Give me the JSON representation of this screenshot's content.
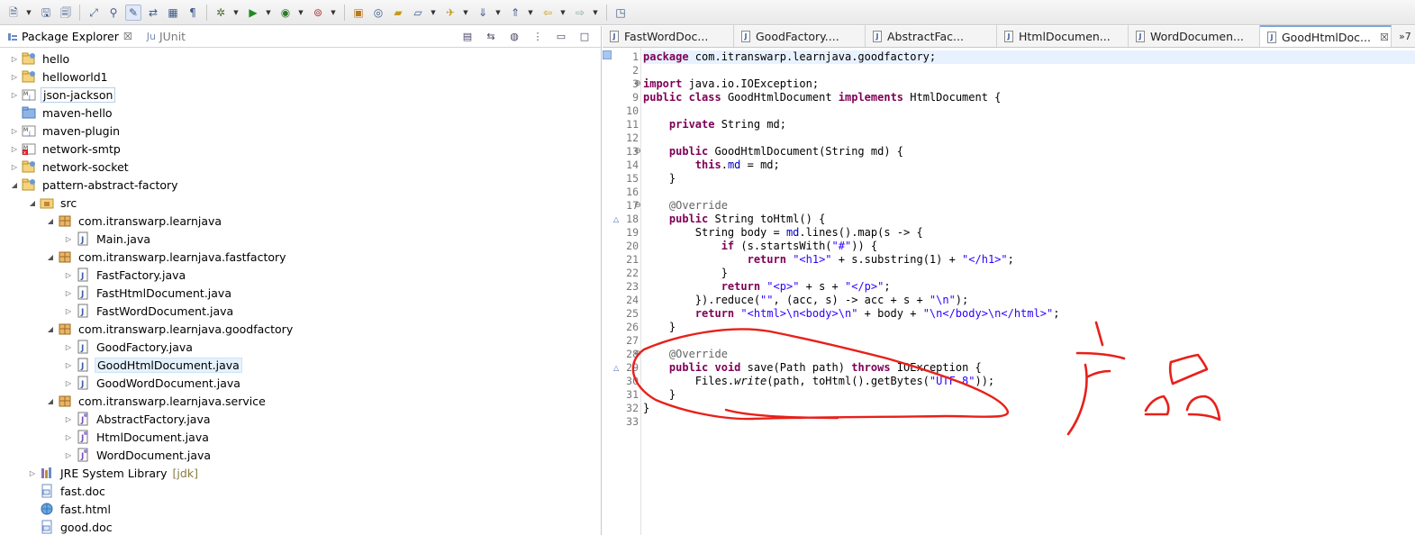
{
  "toolbar": {
    "buttons": [
      "new-icon",
      "save-icon",
      "save-all-icon",
      "pin-icon",
      "toggle-marker-icon",
      "mark-occurrences-icon",
      "next-annotation-icon",
      "block-icon",
      "paragraph-icon",
      "debug-icon",
      "run-icon",
      "coverage-icon",
      "external-tools-icon",
      "new-package-icon",
      "new-class-icon",
      "open-type-icon",
      "open-task-icon",
      "search-icon",
      "next-edit-icon",
      "prev-edit-icon",
      "back-icon",
      "forward-icon",
      "maximize-icon"
    ]
  },
  "explorer": {
    "tabs": [
      {
        "label": "Package Explorer",
        "close": "☒"
      },
      {
        "label": "JUnit",
        "prefix": "Ju"
      }
    ],
    "tree": [
      {
        "label": "hello"
      },
      {
        "label": "helloworld1"
      },
      {
        "label": "json-jackson"
      },
      {
        "label": "maven-hello"
      },
      {
        "label": "maven-plugin"
      },
      {
        "label": "network-smtp"
      },
      {
        "label": "network-socket"
      },
      {
        "label": "pattern-abstract-factory"
      },
      {
        "label": "src"
      },
      {
        "label": "com.itranswarp.learnjava"
      },
      {
        "label": "Main.java"
      },
      {
        "label": "com.itranswarp.learnjava.fastfactory"
      },
      {
        "label": "FastFactory.java"
      },
      {
        "label": "FastHtmlDocument.java"
      },
      {
        "label": "FastWordDocument.java"
      },
      {
        "label": "com.itranswarp.learnjava.goodfactory"
      },
      {
        "label": "GoodFactory.java"
      },
      {
        "label": "GoodHtmlDocument.java"
      },
      {
        "label": "GoodWordDocument.java"
      },
      {
        "label": "com.itranswarp.learnjava.service"
      },
      {
        "label": "AbstractFactory.java"
      },
      {
        "label": "HtmlDocument.java"
      },
      {
        "label": "WordDocument.java"
      },
      {
        "label": "JRE System Library",
        "decor": "[jdk]"
      },
      {
        "label": "fast.doc"
      },
      {
        "label": "fast.html"
      },
      {
        "label": "good.doc"
      }
    ]
  },
  "editor": {
    "tabs": [
      "FastWordDoc...",
      "GoodFactory....",
      "AbstractFac...",
      "HtmlDocumen...",
      "WordDocumen...",
      "GoodHtmlDoc..."
    ],
    "active_tab_close": "☒",
    "overflow": "»7",
    "line_numbers": [
      "1",
      "2",
      "3",
      "9",
      "10",
      "11",
      "12",
      "13",
      "14",
      "15",
      "16",
      "17",
      "18",
      "19",
      "20",
      "21",
      "22",
      "23",
      "24",
      "25",
      "26",
      "27",
      "28",
      "29",
      "30",
      "31",
      "32",
      "33"
    ],
    "code": [
      "package com.itranswarp.learnjava.goodfactory;",
      "",
      "import java.io.IOException;",
      "public class GoodHtmlDocument implements HtmlDocument {",
      "",
      "    private String md;",
      "",
      "    public GoodHtmlDocument(String md) {",
      "        this.md = md;",
      "    }",
      "",
      "    @Override",
      "    public String toHtml() {",
      "        String body = md.lines().map(s -> {",
      "            if (s.startsWith(\"#\")) {",
      "                return \"<h1>\" + s.substring(1) + \"</h1>\";",
      "            }",
      "            return \"<p>\" + s + \"</p>\";",
      "        }).reduce(\"\", (acc, s) -> acc + s + \"\\n\");",
      "        return \"<html>\\n<body>\\n\" + body + \"\\n</body>\\n</html>\";",
      "    }",
      "",
      "    @Override",
      "    public void save(Path path) throws IOException {",
      "        Files.write(path, toHtml().getBytes(\"UTF-8\"));",
      "    }",
      "}",
      ""
    ]
  },
  "annotation": {
    "handwriting": "产品",
    "color": "#e8201a"
  },
  "colors": {
    "keyword": "#7f0055",
    "string": "#2a00ff",
    "annotation": "#646464",
    "field": "#0000c0",
    "line_highlight": "#e8f2fe"
  }
}
